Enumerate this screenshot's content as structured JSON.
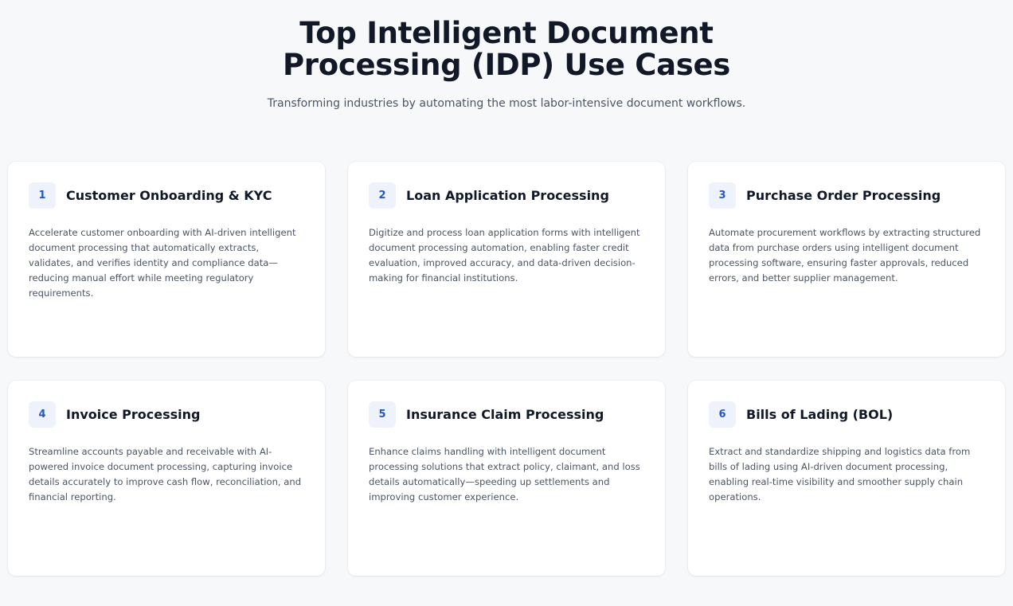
{
  "hero": {
    "title": "Top Intelligent Document Processing (IDP) Use Cases",
    "subtitle": "Transforming industries by automating the most labor-intensive document workflows."
  },
  "cards": [
    {
      "number": "1",
      "title": "Customer Onboarding & KYC",
      "description": "Accelerate customer onboarding with AI-driven intelligent document processing that automatically extracts, validates, and verifies identity and compliance data—reducing manual effort while meeting regulatory requirements."
    },
    {
      "number": "2",
      "title": "Loan Application Processing",
      "description": "Digitize and process loan application forms with intelligent document processing automation, enabling faster credit evaluation, improved accuracy, and data-driven decision-making for financial institutions."
    },
    {
      "number": "3",
      "title": "Purchase Order Processing",
      "description": "Automate procurement workflows by extracting structured data from purchase orders using intelligent document processing software, ensuring faster approvals, reduced errors, and better supplier management."
    },
    {
      "number": "4",
      "title": "Invoice Processing",
      "description": "Streamline accounts payable and receivable with AI-powered invoice document processing, capturing invoice details accurately to improve cash flow, reconciliation, and financial reporting."
    },
    {
      "number": "5",
      "title": "Insurance Claim Processing",
      "description": "Enhance claims handling with intelligent document processing solutions that extract policy, claimant, and loss details automatically—speeding up settlements and improving customer experience."
    },
    {
      "number": "6",
      "title": "Bills of Lading (BOL)",
      "description": "Extract and standardize shipping and logistics data from bills of lading using AI-driven document processing, enabling real-time visibility and smoother supply chain operations."
    }
  ],
  "colors": {
    "background": "#f7f8fa",
    "card": "#ffffff",
    "badge_bg": "#eef2fb",
    "accent": "#2556c4",
    "heading": "#111827",
    "body_text": "#4b5563"
  }
}
